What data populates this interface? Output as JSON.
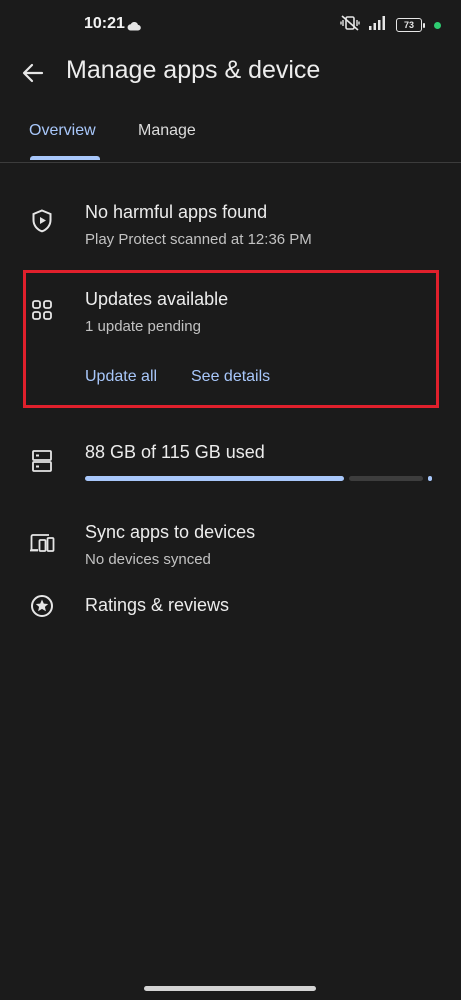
{
  "status_bar": {
    "time": "10:21",
    "battery_level": "73"
  },
  "app_bar": {
    "title": "Manage apps & device"
  },
  "tabs": [
    {
      "label": "Overview",
      "selected": true
    },
    {
      "label": "Manage",
      "selected": false
    }
  ],
  "play_protect": {
    "title": "No harmful apps found",
    "subtitle": "Play Protect scanned at 12:36 PM"
  },
  "updates": {
    "title": "Updates available",
    "subtitle": "1 update pending",
    "update_all_label": "Update all",
    "see_details_label": "See details"
  },
  "storage": {
    "label": "88 GB of 115 GB used",
    "used_fraction": 0.765
  },
  "sync": {
    "title": "Sync apps to devices",
    "subtitle": "No devices synced"
  },
  "ratings": {
    "title": "Ratings & reviews"
  },
  "colors": {
    "accent": "#a8c7fa",
    "background": "#1b1b1b",
    "highlight": "#e0202c"
  },
  "icons": [
    "back-arrow-icon",
    "play-protect-shield-icon",
    "apps-grid-icon",
    "storage-icon",
    "devices-icon",
    "star-circle-icon"
  ]
}
